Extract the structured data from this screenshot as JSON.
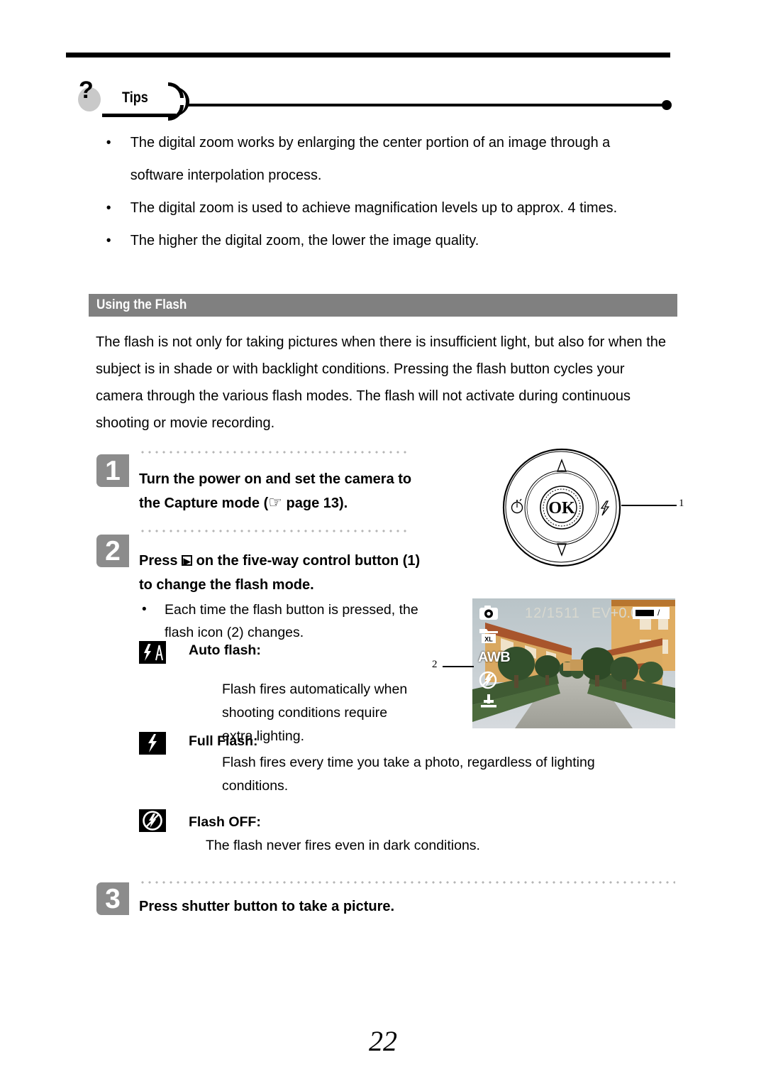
{
  "page": {
    "number": "22"
  },
  "tips": {
    "badge_icon": "question-mark-icon",
    "label": "Tips",
    "items": [
      "The digital zoom works by enlarging the center portion of an image through a software interpolation process.",
      "The digital zoom is used to achieve magnification levels up to approx. 4 times.",
      "The higher the digital zoom, the lower the image quality."
    ],
    "bullet_glyph": "•"
  },
  "section": {
    "title": "Using the Flash",
    "bar_color": "#808080",
    "intro": "The flash is not only for taking pictures when there is insufficient light, but also for when the subject is in shade or with backlight conditions. Pressing the flash button cycles your camera through the various flash modes. The flash will not activate during continuous shooting or movie recording."
  },
  "steps": [
    {
      "number": "1",
      "text_part1": "Turn the power on and set the camera to the Capture mode (",
      "hand_glyph": "☞",
      "text_part2": " page 13)."
    },
    {
      "number": "2",
      "text_part1": "Press ",
      "arrow_glyph": "▶",
      "text_part2": " on the five-way control button (1) to change the flash mode."
    },
    {
      "number": "3",
      "text": "Press shutter button to take a picture."
    }
  ],
  "sub_bullet": {
    "glyph": "•",
    "text": "Each time the flash button is pressed, the flash icon (2) changes."
  },
  "flash_modes": [
    {
      "icon": "flash-auto-icon",
      "title": "Auto flash:",
      "description": "Flash fires automatically when shooting conditions require extra lighting."
    },
    {
      "icon": "flash-full-icon",
      "title": "Full Flash:",
      "description": "Flash fires every time you take a photo, regardless of lighting conditions."
    },
    {
      "icon": "flash-off-icon",
      "title": "Flash OFF:",
      "description": "The flash never fires even in dark conditions."
    }
  ],
  "dial": {
    "center_label": "OK",
    "callout_label": "1",
    "up_icon": "triangle-up-icon",
    "down_icon": "triangle-down-icon",
    "left_icon": "self-timer-icon",
    "right_icon": "flash-icon"
  },
  "lcd": {
    "callout_label": "2",
    "counter": "12/1511",
    "ev": "EV+0.0",
    "awb": "AWB",
    "battery_slash": "/",
    "icons": {
      "mode": "camera-mode-icon",
      "resolution": "resolution-xl-icon",
      "white_balance": "awb-label",
      "flash": "flash-off-icon",
      "quality": "quality-icon"
    }
  }
}
